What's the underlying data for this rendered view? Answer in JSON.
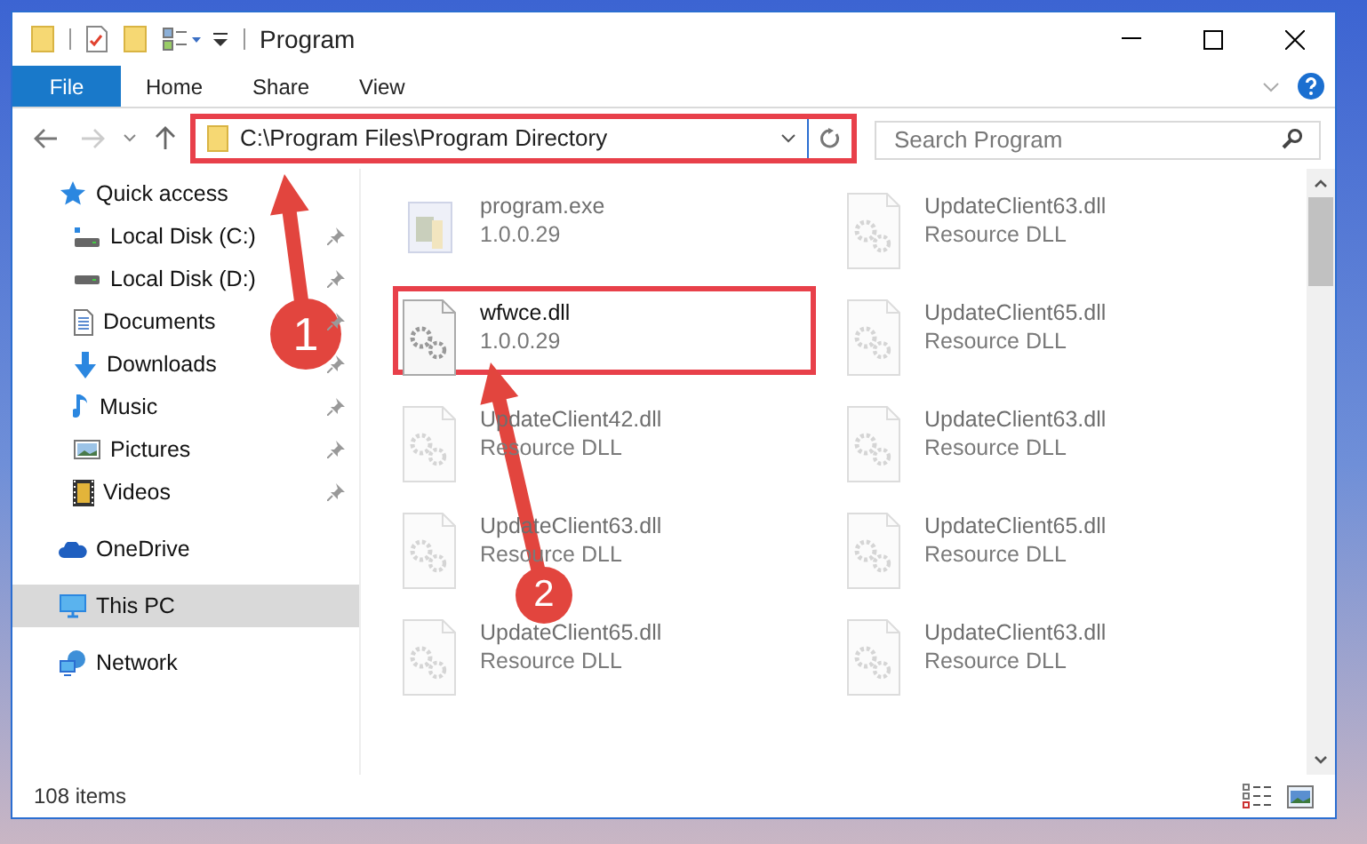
{
  "window": {
    "title": "Program"
  },
  "ribbon_tabs": [
    {
      "label": "File",
      "kind": "file"
    },
    {
      "label": "Home",
      "kind": "tab"
    },
    {
      "label": "Share",
      "kind": "tab"
    },
    {
      "label": "View",
      "kind": "tab"
    }
  ],
  "address_bar": {
    "path": "C:\\Program Files\\Program Directory",
    "highlighted": true
  },
  "search": {
    "placeholder": "Search Program"
  },
  "nav_pane": [
    {
      "label": "Quick access",
      "selected": false,
      "children": [
        {
          "label": "Local Disk (C:)",
          "pinned": true,
          "selected": false
        },
        {
          "label": "Local Disk (D:)",
          "pinned": true,
          "selected": false
        },
        {
          "label": "Documents",
          "pinned": true,
          "selected": false
        },
        {
          "label": "Downloads",
          "pinned": true,
          "selected": false
        },
        {
          "label": "Music",
          "pinned": true,
          "selected": false
        },
        {
          "label": "Pictures",
          "pinned": true,
          "selected": false
        },
        {
          "label": "Videos",
          "pinned": true,
          "selected": false
        }
      ]
    },
    {
      "label": "OneDrive",
      "selected": false
    },
    {
      "label": "This PC",
      "selected": true
    },
    {
      "label": "Network",
      "selected": false
    }
  ],
  "files": [
    {
      "name": "program.exe",
      "detail": "1.0.0.29",
      "kind": "exe",
      "dimmed": true,
      "highlighted": false
    },
    {
      "name": "UpdateClient63.dll",
      "detail": "Resource DLL",
      "kind": "dll",
      "dimmed": true,
      "highlighted": false
    },
    {
      "name": "wfwce.dll",
      "detail": "1.0.0.29",
      "kind": "dll",
      "dimmed": false,
      "highlighted": true
    },
    {
      "name": "UpdateClient65.dll",
      "detail": "Resource DLL",
      "kind": "dll",
      "dimmed": true,
      "highlighted": false
    },
    {
      "name": "UpdateClient42.dll",
      "detail": "Resource DLL",
      "kind": "dll",
      "dimmed": true,
      "highlighted": false
    },
    {
      "name": "UpdateClient63.dll",
      "detail": "Resource DLL",
      "kind": "dll",
      "dimmed": true,
      "highlighted": false
    },
    {
      "name": "UpdateClient63.dll",
      "detail": "Resource DLL",
      "kind": "dll",
      "dimmed": true,
      "highlighted": false
    },
    {
      "name": "UpdateClient65.dll",
      "detail": "Resource DLL",
      "kind": "dll",
      "dimmed": true,
      "highlighted": false
    },
    {
      "name": "UpdateClient65.dll",
      "detail": "Resource DLL",
      "kind": "dll",
      "dimmed": true,
      "highlighted": false
    },
    {
      "name": "UpdateClient63.dll",
      "detail": "Resource DLL",
      "kind": "dll",
      "dimmed": true,
      "highlighted": false
    }
  ],
  "callouts": [
    {
      "number": "1"
    },
    {
      "number": "2"
    }
  ],
  "status_bar": {
    "item_count": "108 items"
  }
}
